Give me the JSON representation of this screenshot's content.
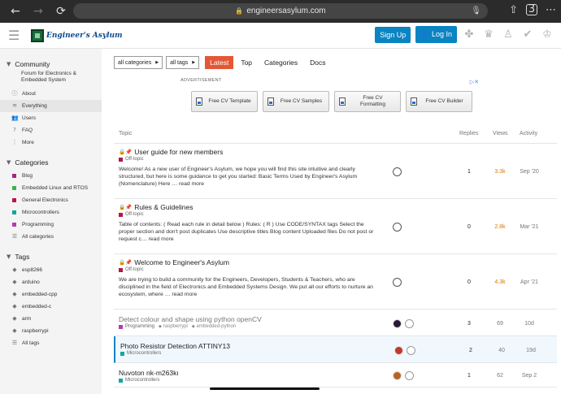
{
  "browser": {
    "back": "←",
    "forward": "→",
    "reload": "⟳",
    "lock": "🔒",
    "url": "engineersasylum.com",
    "mic": "🎙",
    "share": "⇧",
    "tabs": "3",
    "more": "⋯"
  },
  "header": {
    "logo_text": "Engineer's Asylum",
    "signup_label": "Sign Up",
    "login_label": "Log In",
    "login_icon": "👤",
    "icons": [
      "search-icon",
      "hamburger-icon",
      "user-icon"
    ]
  },
  "sidebar": {
    "community": {
      "title": "Community",
      "description": "Forum for Electronics & Embedded System",
      "items": [
        {
          "label": "About",
          "icon": "ⓘ"
        },
        {
          "label": "Everything",
          "icon": "≋",
          "active": true
        },
        {
          "label": "Users",
          "icon": "👥"
        },
        {
          "label": "FAQ",
          "icon": "?"
        },
        {
          "label": "More",
          "icon": "⋮"
        }
      ]
    },
    "categories": {
      "title": "Categories",
      "items": [
        {
          "label": "Blog",
          "color": "#a3287d"
        },
        {
          "label": "Embedded Linux and RTOS",
          "color": "#3ab54a"
        },
        {
          "label": "General Electronics",
          "color": "#b3174c"
        },
        {
          "label": "Microcontrollers",
          "color": "#0fa7a0"
        },
        {
          "label": "Programming",
          "color": "#b23cb3"
        },
        {
          "label": "All categories",
          "icon": "☰"
        }
      ]
    },
    "tags": {
      "title": "Tags",
      "items": [
        {
          "label": "esp8266"
        },
        {
          "label": "arduino"
        },
        {
          "label": "embedded-cpp"
        },
        {
          "label": "embedded-c"
        },
        {
          "label": "arm"
        },
        {
          "label": "raspberrypi"
        },
        {
          "label": "All tags",
          "icon": "☰"
        }
      ]
    }
  },
  "filters": {
    "categories_dd": "all categories",
    "tags_dd": "all tags",
    "tabs": [
      {
        "label": "Latest",
        "active": true
      },
      {
        "label": "Top"
      },
      {
        "label": "Categories"
      },
      {
        "label": "Docs"
      }
    ]
  },
  "ad": {
    "label": "ADVERTISEMENT",
    "buttons": [
      {
        "label": "Free CV Template"
      },
      {
        "label": "Free CV Samples"
      },
      {
        "label": "Free CV Formatting"
      },
      {
        "label": "Free CV Builder"
      }
    ]
  },
  "table": {
    "headers": {
      "topic": "Topic",
      "replies": "Replies",
      "views": "Views",
      "activity": "Activity"
    },
    "rows": [
      {
        "title": "User guide for new members",
        "pinned": true,
        "category": "Off-topic",
        "category_color": "#b3174c",
        "excerpt": "Welcome! As a new user of Engineer's Asylum, we hope you will find this site intuitive and clearly structured, but here is some guidance to get you started: Basic Terms Used by Engineer's Asylum (Nomenclature) Here … read more",
        "replies": "1",
        "views": "3.3k",
        "views_hot": true,
        "activity": "Sep '20"
      },
      {
        "title": "Rules & Guidelines",
        "pinned": true,
        "category": "Off-topic",
        "category_color": "#b3174c",
        "excerpt": "Table of contents: ( Read each rule in detail below ) Rules: ( R ) Use CODE/SYNTAX tags Select the proper section and don't post duplicates Use descriptive titles Blog content Uploaded files Do not post or request c… read more",
        "replies": "0",
        "views": "2.8k",
        "views_hot": true,
        "activity": "Mar '21"
      },
      {
        "title": "Welcome to Engineer's Asylum",
        "pinned": true,
        "category": "Off-topic",
        "category_color": "#b3174c",
        "excerpt": "We are trying to build a community for the Engineers, Developers, Students & Teachers, who are disciplined in the field of Electronics and Embedded Systems Design. We put all our efforts to nurture an ecosystem, where … read more",
        "replies": "0",
        "views": "4.3k",
        "views_hot": true,
        "activity": "Apr '21"
      },
      {
        "title": "Detect colour and shape using python openCV",
        "category": "Programming",
        "category_color": "#b23cb3",
        "tags": [
          "raspberrypi",
          "embedded-python"
        ],
        "replies": "3",
        "views": "69",
        "activity": "10d"
      },
      {
        "title": "Photo Resistor Detection ATTINY13",
        "category": "Microcontrollers",
        "category_color": "#0fa7a0",
        "replies": "2",
        "views": "40",
        "activity": "19d"
      },
      {
        "title": "Nuvoton nk-m263kı",
        "category": "Microcontrollers",
        "category_color": "#0fa7a0",
        "replies": "1",
        "views": "62",
        "activity": "Sep 2"
      }
    ]
  }
}
